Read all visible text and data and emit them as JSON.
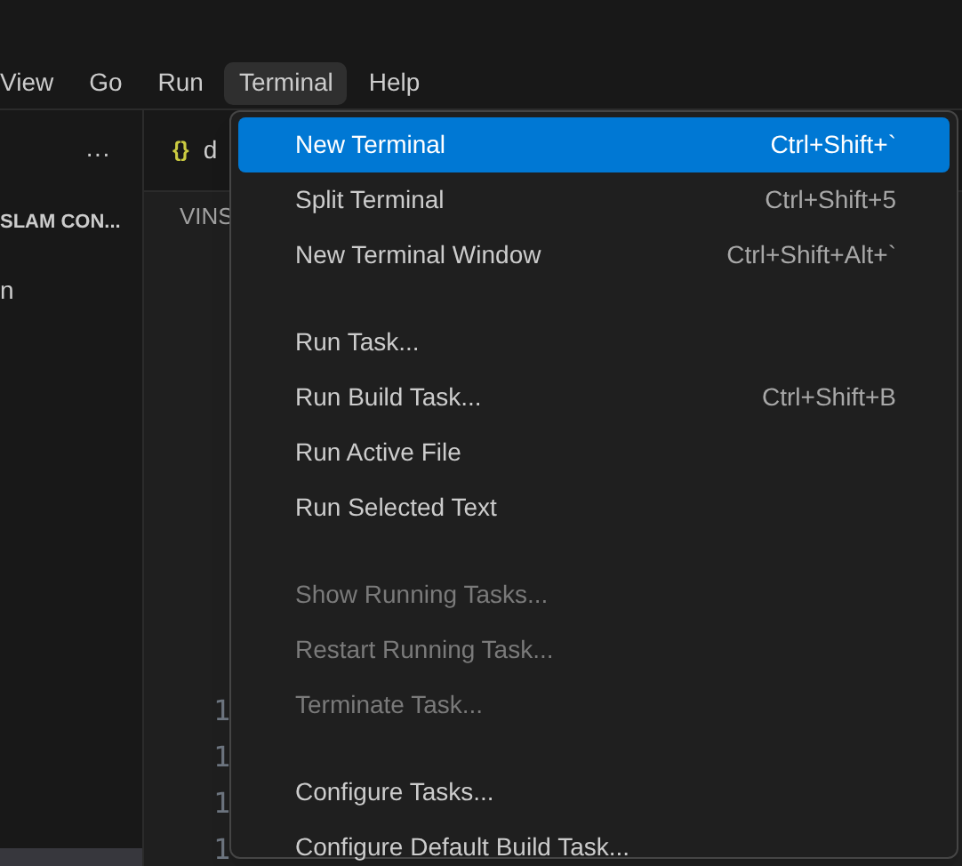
{
  "menubar": [
    {
      "label": "View",
      "selected": false
    },
    {
      "label": "Go",
      "selected": false
    },
    {
      "label": "Run",
      "selected": false
    },
    {
      "label": "Terminal",
      "selected": true
    },
    {
      "label": "Help",
      "selected": false
    }
  ],
  "sidebar": {
    "more": "···",
    "section_title": "SLAM CON...",
    "items": [
      {
        "label": "n"
      }
    ]
  },
  "editor": {
    "tab": {
      "icon": "{}",
      "label": "d"
    },
    "breadcrumb": "VINS",
    "line_numbers": [
      "1",
      "1",
      "1",
      "1"
    ]
  },
  "terminal_menu": {
    "groups": [
      [
        {
          "label": "New Terminal",
          "shortcut": "Ctrl+Shift+`",
          "selected": true,
          "disabled": false
        },
        {
          "label": "Split Terminal",
          "shortcut": "Ctrl+Shift+5",
          "selected": false,
          "disabled": false
        },
        {
          "label": "New Terminal Window",
          "shortcut": "Ctrl+Shift+Alt+`",
          "selected": false,
          "disabled": false
        }
      ],
      [
        {
          "label": "Run Task...",
          "selected": false,
          "disabled": false
        },
        {
          "label": "Run Build Task...",
          "shortcut": "Ctrl+Shift+B",
          "selected": false,
          "disabled": false
        },
        {
          "label": "Run Active File",
          "selected": false,
          "disabled": false
        },
        {
          "label": "Run Selected Text",
          "selected": false,
          "disabled": false
        }
      ],
      [
        {
          "label": "Show Running Tasks...",
          "selected": false,
          "disabled": true
        },
        {
          "label": "Restart Running Task...",
          "selected": false,
          "disabled": true
        },
        {
          "label": "Terminate Task...",
          "selected": false,
          "disabled": true
        }
      ],
      [
        {
          "label": "Configure Tasks...",
          "selected": false,
          "disabled": false
        },
        {
          "label": "Configure Default Build Task...",
          "selected": false,
          "disabled": false
        }
      ]
    ]
  }
}
